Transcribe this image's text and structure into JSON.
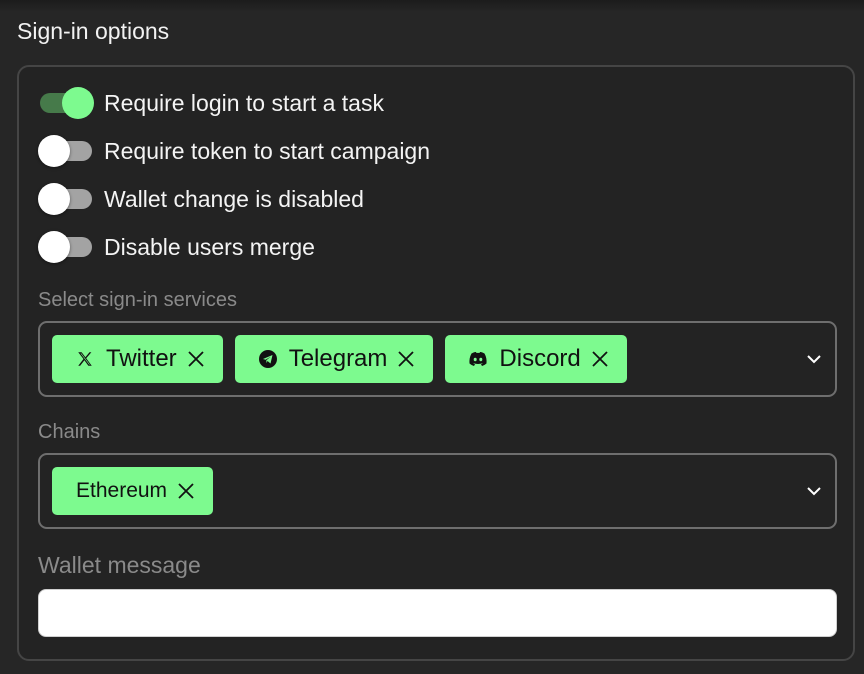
{
  "section": {
    "title": "Sign-in options"
  },
  "toggles": [
    {
      "label": "Require login to start a task",
      "on": true
    },
    {
      "label": "Require token to start campaign",
      "on": false
    },
    {
      "label": "Wallet change is disabled",
      "on": false
    },
    {
      "label": "Disable users merge",
      "on": false
    }
  ],
  "services": {
    "label": "Select sign-in services",
    "chips": [
      {
        "label": "Twitter",
        "icon": "x-logo-icon"
      },
      {
        "label": "Telegram",
        "icon": "telegram-icon"
      },
      {
        "label": "Discord",
        "icon": "discord-icon"
      }
    ]
  },
  "chains": {
    "label": "Chains",
    "chips": [
      {
        "label": "Ethereum"
      }
    ]
  },
  "wallet_message": {
    "label": "Wallet message",
    "value": ""
  },
  "colors": {
    "background": "#262626",
    "accent": "#7dfa8f",
    "toggle_on_track": "#467a4a",
    "toggle_off_track": "#a3a3a3",
    "border": "#6e6e6e"
  }
}
